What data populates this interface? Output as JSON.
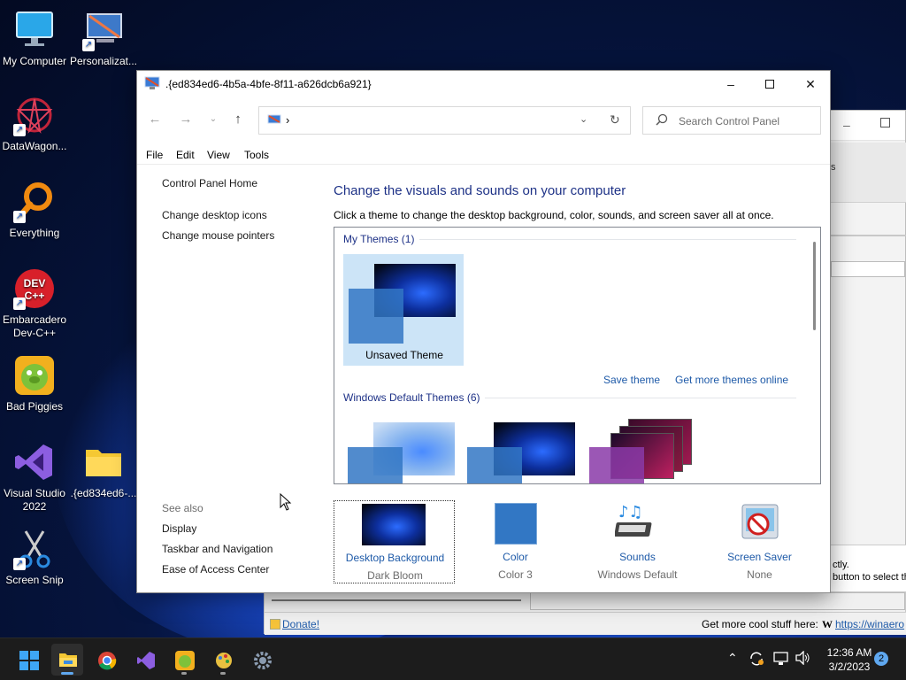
{
  "desktop": {
    "icons": [
      {
        "label": "My Computer"
      },
      {
        "label": "Personalizat..."
      },
      {
        "label": "DataWagon..."
      },
      {
        "label": "Everything"
      },
      {
        "label": "Embarcadero Dev-C++"
      },
      {
        "label": "Bad Piggies"
      },
      {
        "label": "Visual Studio 2022"
      },
      {
        "label": ".{ed834ed6-..."
      },
      {
        "label": "Screen Snip"
      }
    ]
  },
  "window": {
    "title": ".{ed834ed6-4b5a-4bfe-8f11-a626dcb6a921}",
    "address_chevron": "›",
    "search_placeholder": "Search Control Panel",
    "menu": [
      "File",
      "Edit",
      "View",
      "Tools"
    ],
    "left_pane": {
      "home": "Control Panel Home",
      "links": [
        "Change desktop icons",
        "Change mouse pointers"
      ],
      "see_also_title": "See also",
      "see_also": [
        "Display",
        "Taskbar and Navigation",
        "Ease of Access Center"
      ]
    },
    "heading": "Change the visuals and sounds on your computer",
    "description": "Click a theme to change the desktop background, color, sounds, and screen saver all at once.",
    "my_themes": {
      "title": "My Themes (1)",
      "items": [
        {
          "name": "Unsaved Theme",
          "selected": true
        }
      ],
      "save_link": "Save theme",
      "more_link": "Get more themes online"
    },
    "default_themes": {
      "title": "Windows Default Themes (6)"
    },
    "bottom_items": [
      {
        "label": "Desktop Background",
        "value": "Dark Bloom"
      },
      {
        "label": "Color",
        "value": "Color 3"
      },
      {
        "label": "Sounds",
        "value": "Windows Default"
      },
      {
        "label": "Screen Saver",
        "value": "None"
      }
    ]
  },
  "background_window": {
    "text_1": "ctly.",
    "text_2": "button to select th",
    "donate": "Donate!",
    "more_stuff": "Get more cool stuff here:",
    "url": "https://winaero"
  },
  "taskbar": {
    "time": "12:36 AM",
    "date": "3/2/2023",
    "notifications": "2"
  },
  "colors": {
    "accent_link": "#1e5aa8",
    "heading_blue": "#1e3287",
    "selection": "#cce4f7"
  }
}
